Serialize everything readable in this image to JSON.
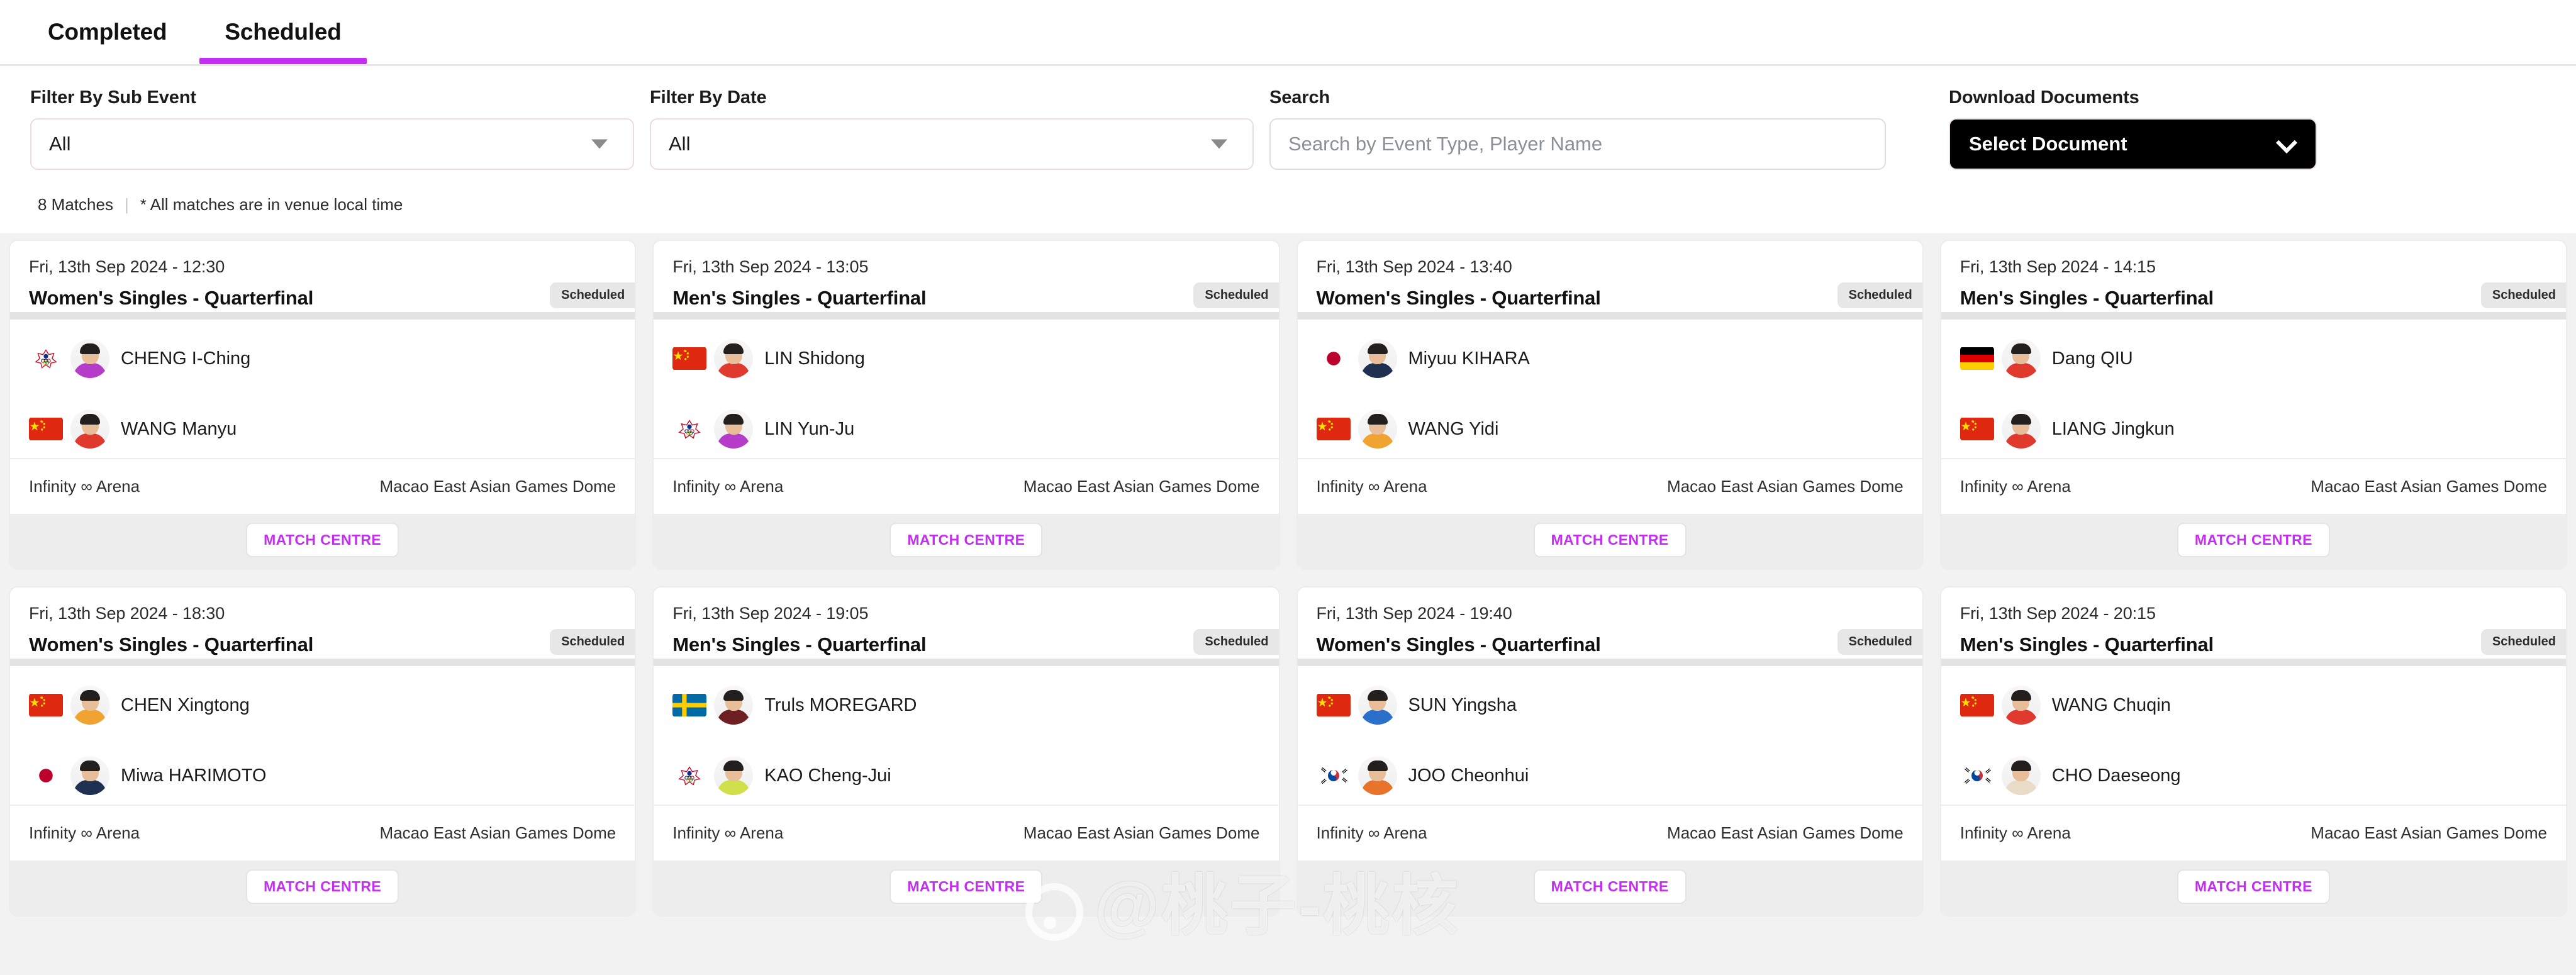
{
  "tabs": [
    {
      "label": "Completed",
      "active": false
    },
    {
      "label": "Scheduled",
      "active": true
    }
  ],
  "filters": {
    "sub_event": {
      "label": "Filter By Sub Event",
      "value": "All"
    },
    "date": {
      "label": "Filter By Date",
      "value": "All"
    },
    "search": {
      "label": "Search",
      "value": "",
      "placeholder": "Search by Event Type, Player Name"
    },
    "documents": {
      "label": "Download Documents",
      "value": "Select Document"
    }
  },
  "meta": {
    "match_count": "8 Matches",
    "divider": "|",
    "note": "* All matches are in venue local time"
  },
  "card_labels": {
    "status": "Scheduled",
    "match_centre": "MATCH CENTRE",
    "court": "Infinity ∞ Arena",
    "venue": "Macao East Asian Games Dome"
  },
  "colors": {
    "accent": "#c42ef0",
    "page_bg": "#f2f2f2",
    "card_bg": "#ffffff",
    "badge_bg": "#e7e7e7",
    "doc_button_bg": "#000000"
  },
  "watermark": "@桃子-桃核",
  "matches": [
    {
      "datetime": "Fri, 13th Sep 2024 - 12:30",
      "title": "Women's Singles - Quarterfinal",
      "status": "Scheduled",
      "court": "Infinity ∞ Arena",
      "venue": "Macao East Asian Games Dome",
      "button": "MATCH CENTRE",
      "players": [
        {
          "name": "CHENG I-Ching",
          "flag": "tpe",
          "kit": "#b43cc8"
        },
        {
          "name": "WANG Manyu",
          "flag": "chn",
          "kit": "#e03a2f"
        }
      ]
    },
    {
      "datetime": "Fri, 13th Sep 2024 - 13:05",
      "title": "Men's Singles - Quarterfinal",
      "status": "Scheduled",
      "court": "Infinity ∞ Arena",
      "venue": "Macao East Asian Games Dome",
      "button": "MATCH CENTRE",
      "players": [
        {
          "name": "LIN Shidong",
          "flag": "chn",
          "kit": "#e03a2f"
        },
        {
          "name": "LIN Yun-Ju",
          "flag": "tpe",
          "kit": "#b43cc8"
        }
      ]
    },
    {
      "datetime": "Fri, 13th Sep 2024 - 13:40",
      "title": "Women's Singles - Quarterfinal",
      "status": "Scheduled",
      "court": "Infinity ∞ Arena",
      "venue": "Macao East Asian Games Dome",
      "button": "MATCH CENTRE",
      "players": [
        {
          "name": "Miyuu KIHARA",
          "flag": "jpn",
          "kit": "#1f3050"
        },
        {
          "name": "WANG Yidi",
          "flag": "chn",
          "kit": "#f0a330"
        }
      ]
    },
    {
      "datetime": "Fri, 13th Sep 2024 - 14:15",
      "title": "Men's Singles - Quarterfinal",
      "status": "Scheduled",
      "court": "Infinity ∞ Arena",
      "venue": "Macao East Asian Games Dome",
      "button": "MATCH CENTRE",
      "players": [
        {
          "name": "Dang QIU",
          "flag": "ger",
          "kit": "#e03a2f"
        },
        {
          "name": "LIANG Jingkun",
          "flag": "chn",
          "kit": "#e03a2f"
        }
      ]
    },
    {
      "datetime": "Fri, 13th Sep 2024 - 18:30",
      "title": "Women's Singles - Quarterfinal",
      "status": "Scheduled",
      "court": "Infinity ∞ Arena",
      "venue": "Macao East Asian Games Dome",
      "button": "MATCH CENTRE",
      "players": [
        {
          "name": "CHEN Xingtong",
          "flag": "chn",
          "kit": "#f0a330"
        },
        {
          "name": "Miwa HARIMOTO",
          "flag": "jpn",
          "kit": "#1f3050"
        }
      ]
    },
    {
      "datetime": "Fri, 13th Sep 2024 - 19:05",
      "title": "Men's Singles - Quarterfinal",
      "status": "Scheduled",
      "court": "Infinity ∞ Arena",
      "venue": "Macao East Asian Games Dome",
      "button": "MATCH CENTRE",
      "players": [
        {
          "name": "Truls MOREGARD",
          "flag": "swe",
          "kit": "#6e1f22"
        },
        {
          "name": "KAO Cheng-Jui",
          "flag": "tpe",
          "kit": "#cfe04a"
        }
      ]
    },
    {
      "datetime": "Fri, 13th Sep 2024 - 19:40",
      "title": "Women's Singles - Quarterfinal",
      "status": "Scheduled",
      "court": "Infinity ∞ Arena",
      "venue": "Macao East Asian Games Dome",
      "button": "MATCH CENTRE",
      "players": [
        {
          "name": "SUN Yingsha",
          "flag": "chn",
          "kit": "#2a6fc9"
        },
        {
          "name": "JOO Cheonhui",
          "flag": "kor",
          "kit": "#e8732a"
        }
      ]
    },
    {
      "datetime": "Fri, 13th Sep 2024 - 20:15",
      "title": "Men's Singles - Quarterfinal",
      "status": "Scheduled",
      "court": "Infinity ∞ Arena",
      "venue": "Macao East Asian Games Dome",
      "button": "MATCH CENTRE",
      "players": [
        {
          "name": "WANG Chuqin",
          "flag": "chn",
          "kit": "#e03a2f"
        },
        {
          "name": "CHO Daeseong",
          "flag": "kor",
          "kit": "#e8dcc8"
        }
      ]
    }
  ]
}
